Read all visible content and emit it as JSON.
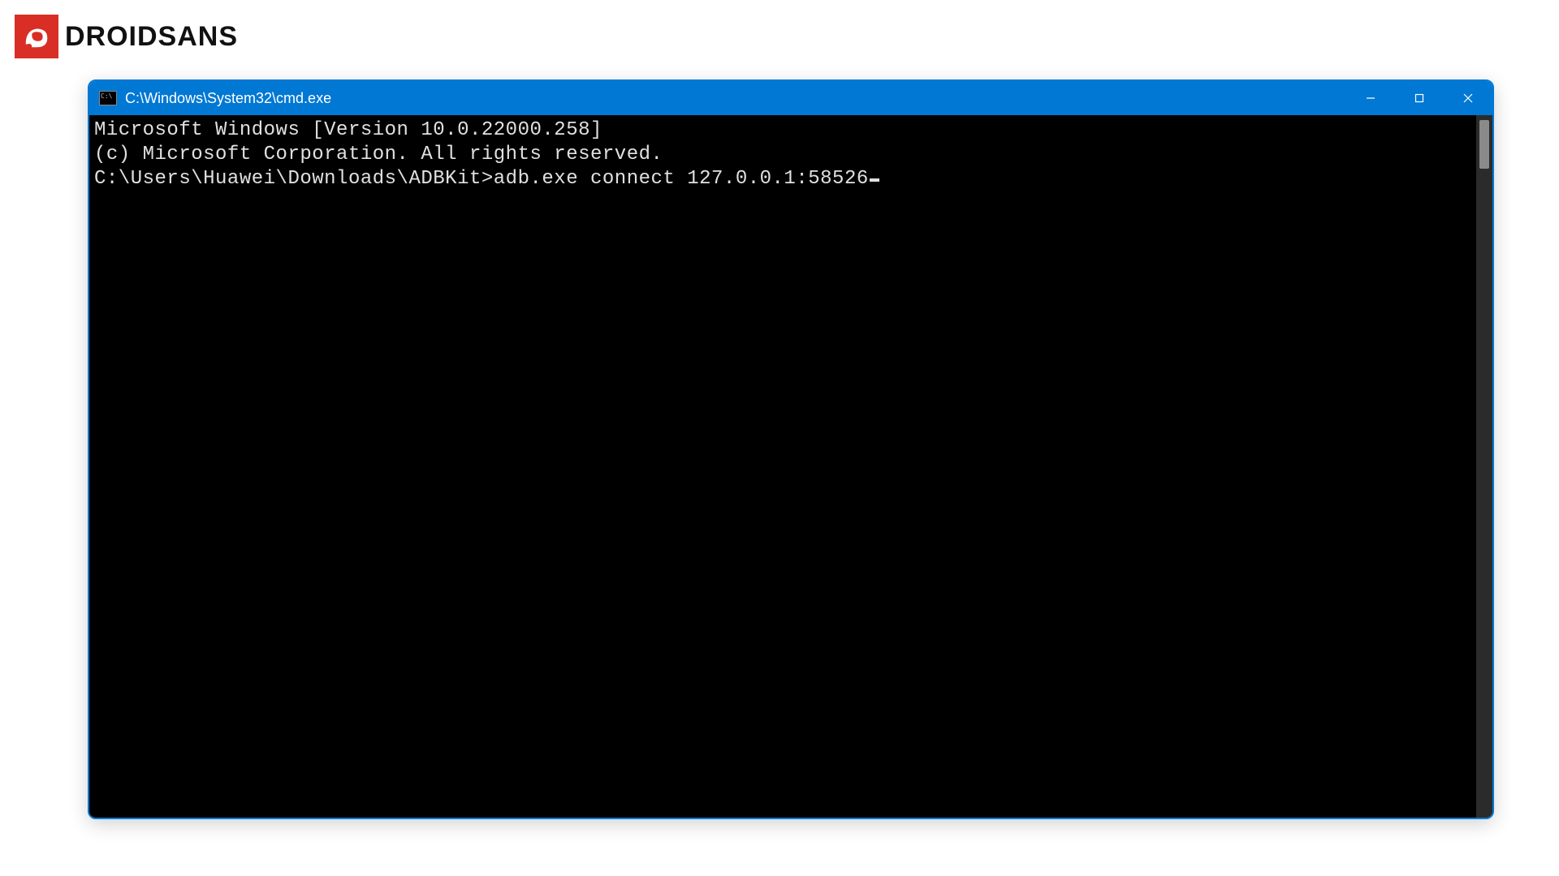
{
  "brand": {
    "name": "DROIDSANS",
    "logo_color": "#d92e25"
  },
  "window": {
    "title": "C:\\Windows\\System32\\cmd.exe",
    "titlebar_color": "#0078d4",
    "controls": {
      "minimize": "minimize",
      "maximize": "maximize",
      "close": "close"
    }
  },
  "terminal": {
    "lines": [
      "Microsoft Windows [Version 10.0.22000.258]",
      "(c) Microsoft Corporation. All rights reserved.",
      "",
      "C:\\Users\\Huawei\\Downloads\\ADBKit>adb.exe connect 127.0.0.1:58526"
    ],
    "background": "#000000",
    "foreground": "#e0e0e0"
  }
}
